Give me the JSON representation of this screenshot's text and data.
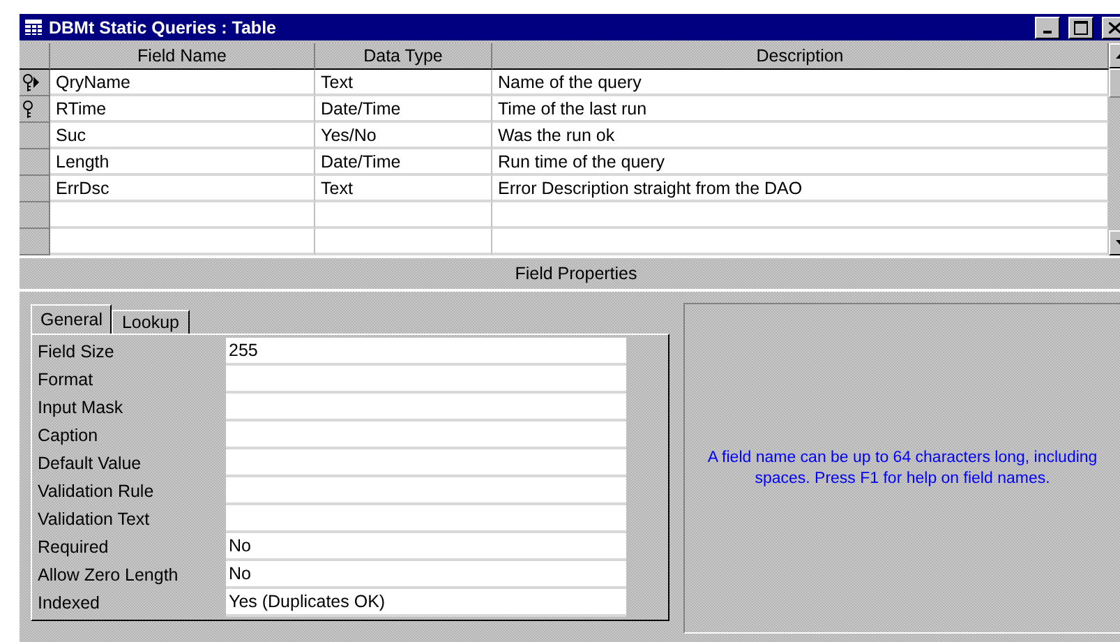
{
  "window": {
    "title": "DBMt Static Queries : Table"
  },
  "table": {
    "columns": [
      "Field Name",
      "Data Type",
      "Description"
    ],
    "rows": [
      {
        "field_name": "QryName",
        "data_type": "Text",
        "description": "Name of the query",
        "primary_key": true,
        "selected": true
      },
      {
        "field_name": "RTime",
        "data_type": "Date/Time",
        "description": "Time of the last run",
        "primary_key": true,
        "selected": false
      },
      {
        "field_name": "Suc",
        "data_type": "Yes/No",
        "description": "Was the run ok",
        "primary_key": false,
        "selected": false
      },
      {
        "field_name": "Length",
        "data_type": "Date/Time",
        "description": "Run time of the query",
        "primary_key": false,
        "selected": false
      },
      {
        "field_name": "ErrDsc",
        "data_type": "Text",
        "description": "Error Description straight from the DAO",
        "primary_key": false,
        "selected": false
      },
      {
        "primary_key": false,
        "selected": false
      },
      {
        "primary_key": false,
        "selected": false
      }
    ]
  },
  "field_properties": {
    "title": "Field Properties",
    "tabs": [
      {
        "label": "General",
        "selected": true
      },
      {
        "label": "Lookup",
        "selected": false
      }
    ],
    "properties": [
      {
        "label": "Field Size",
        "value": "255"
      },
      {
        "label": "Format"
      },
      {
        "label": "Input Mask"
      },
      {
        "label": "Caption"
      },
      {
        "label": "Default Value"
      },
      {
        "label": "Validation Rule"
      },
      {
        "label": "Validation Text"
      },
      {
        "label": "Required",
        "value": "No"
      },
      {
        "label": "Allow Zero Length",
        "value": "No"
      },
      {
        "label": "Indexed",
        "value": "Yes (Duplicates OK)"
      }
    ],
    "hint": "A field name can be up to 64 characters long, including spaces.  Press F1 for help on field names."
  }
}
